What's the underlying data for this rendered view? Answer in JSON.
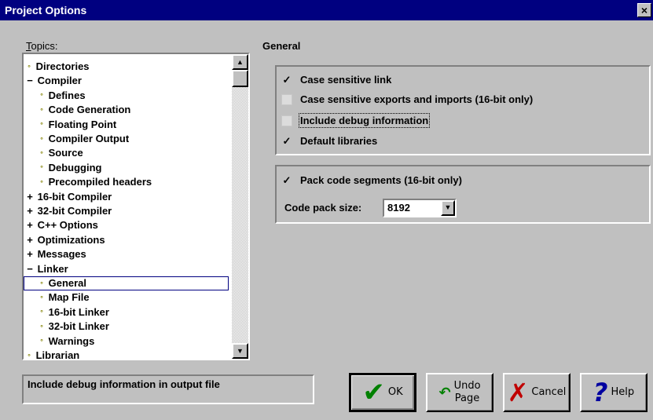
{
  "window": {
    "title": "Project Options",
    "close_label": "×"
  },
  "topics": {
    "label_prefix": "T",
    "label_rest": "opics:",
    "items": [
      {
        "label": "Directories",
        "kind": "leaf",
        "indent": 0
      },
      {
        "label": "Compiler",
        "kind": "minus",
        "indent": 0
      },
      {
        "label": "Defines",
        "kind": "leaf",
        "indent": 1
      },
      {
        "label": "Code Generation",
        "kind": "leaf",
        "indent": 1
      },
      {
        "label": "Floating Point",
        "kind": "leaf",
        "indent": 1
      },
      {
        "label": "Compiler Output",
        "kind": "leaf",
        "indent": 1
      },
      {
        "label": "Source",
        "kind": "leaf",
        "indent": 1
      },
      {
        "label": "Debugging",
        "kind": "leaf",
        "indent": 1
      },
      {
        "label": "Precompiled headers",
        "kind": "leaf",
        "indent": 1
      },
      {
        "label": "16-bit Compiler",
        "kind": "plus",
        "indent": 0
      },
      {
        "label": "32-bit Compiler",
        "kind": "plus",
        "indent": 0
      },
      {
        "label": "C++ Options",
        "kind": "plus",
        "indent": 0
      },
      {
        "label": "Optimizations",
        "kind": "plus",
        "indent": 0
      },
      {
        "label": "Messages",
        "kind": "plus",
        "indent": 0
      },
      {
        "label": "Linker",
        "kind": "minus",
        "indent": 0
      },
      {
        "label": "General",
        "kind": "leaf",
        "indent": 1,
        "selected": true
      },
      {
        "label": "Map File",
        "kind": "leaf",
        "indent": 1
      },
      {
        "label": "16-bit Linker",
        "kind": "leaf",
        "indent": 1
      },
      {
        "label": "32-bit Linker",
        "kind": "leaf",
        "indent": 1
      },
      {
        "label": "Warnings",
        "kind": "leaf",
        "indent": 1
      },
      {
        "label": "Librarian",
        "kind": "leaf",
        "indent": 0
      }
    ]
  },
  "panel": {
    "title": "General",
    "options": [
      {
        "label": "Case sensitive link",
        "checked": true
      },
      {
        "label": "Case sensitive exports and imports (16-bit only)",
        "checked": false
      },
      {
        "label": "Include debug information",
        "checked": false,
        "focused": true
      },
      {
        "label": "Default libraries",
        "checked": true
      }
    ],
    "pack": {
      "label": "Pack code segments (16-bit only)",
      "checked": true
    },
    "code_pack": {
      "label": "Code pack size:",
      "value": "8192"
    }
  },
  "status_text": "Include debug information in output file",
  "buttons": {
    "ok": "OK",
    "undo_line1": "Undo",
    "undo_line2": "Page",
    "cancel": "Cancel",
    "help": "Help"
  },
  "icons": {
    "ok": "checkmark-icon",
    "undo": "undo-arrow-icon",
    "cancel": "red-x-icon",
    "help": "question-mark-icon",
    "scroll_up": "scroll-up-arrow-icon",
    "scroll_down": "scroll-down-arrow-icon"
  }
}
